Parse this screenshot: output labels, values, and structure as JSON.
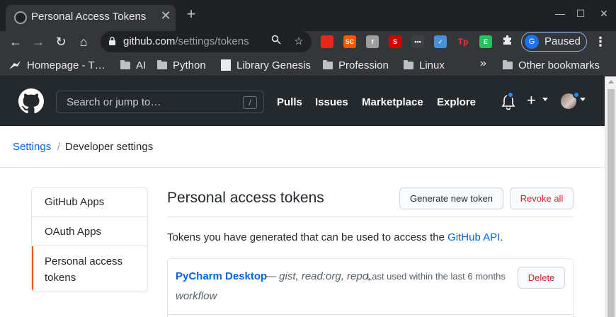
{
  "browser": {
    "tab": {
      "title": "Personal Access Tokens",
      "close": "✕"
    },
    "new_tab": "+",
    "window": {
      "minimize": "—",
      "maximize": "☐",
      "close": "✕"
    },
    "toolbar": {
      "back": "←",
      "forward": "→",
      "reload": "↻",
      "home": "⌂",
      "url_host": "github.com",
      "url_path": "/settings/tokens",
      "extensions": [
        {
          "name": "adblock-extension-icon",
          "label": "",
          "color": "#e8261b"
        },
        {
          "name": "soundcloud-extension-icon",
          "label": "SC",
          "color": "#ff5500"
        },
        {
          "name": "fontface-extension-icon",
          "label": "f",
          "color": "#9e9e9e"
        },
        {
          "name": "s-extension-icon",
          "label": "S",
          "color": "#d50000"
        },
        {
          "name": "dots-extension-icon",
          "label": "•••",
          "color": "#3c4043"
        },
        {
          "name": "compass-extension-icon",
          "label": "✓",
          "color": "#4a90d9"
        },
        {
          "name": "tp-extension-icon",
          "label": "Tp",
          "color": "#35363a"
        },
        {
          "name": "evernote-extension-icon",
          "label": "E",
          "color": "#2dbe60"
        }
      ],
      "profile": {
        "initial": "G",
        "status": "Paused"
      },
      "menu": "⋮"
    },
    "bookmarks": {
      "items": [
        {
          "label": "Homepage - T…",
          "kind": "site"
        },
        {
          "label": "AI",
          "kind": "folder"
        },
        {
          "label": "Python",
          "kind": "folder"
        },
        {
          "label": "Library Genesis",
          "kind": "site"
        },
        {
          "label": "Profession",
          "kind": "folder"
        },
        {
          "label": "Linux",
          "kind": "folder"
        }
      ],
      "overflow": "»",
      "other": "Other bookmarks"
    }
  },
  "github": {
    "search_placeholder": "Search or jump to…",
    "search_shortcut": "/",
    "nav": [
      "Pulls",
      "Issues",
      "Marketplace",
      "Explore"
    ],
    "plus": "+",
    "breadcrumb": {
      "parent": "Settings",
      "separator": "/",
      "current": "Developer settings"
    },
    "sidebar": [
      {
        "label": "GitHub Apps",
        "selected": false
      },
      {
        "label": "OAuth Apps",
        "selected": false
      },
      {
        "label": "Personal access tokens",
        "selected": true
      }
    ],
    "page_title": "Personal access tokens",
    "buttons": {
      "generate": "Generate new token",
      "revoke_all": "Revoke all"
    },
    "description": {
      "text": "Tokens you have generated that can be used to access the ",
      "link": "GitHub API",
      "suffix": "."
    },
    "tokens": [
      {
        "name": "PyCharm Desktop",
        "scopes_line1": "— gist, read:org, repo,",
        "scopes_line2": "workflow",
        "last_used": "Last used within the last 6 months",
        "delete_label": "Delete"
      }
    ]
  },
  "colors": {
    "link": "#0366d6",
    "danger": "#cb2431",
    "header_bg": "#24292e",
    "selected_accent": "#e36209",
    "notification": "#2188ff"
  }
}
